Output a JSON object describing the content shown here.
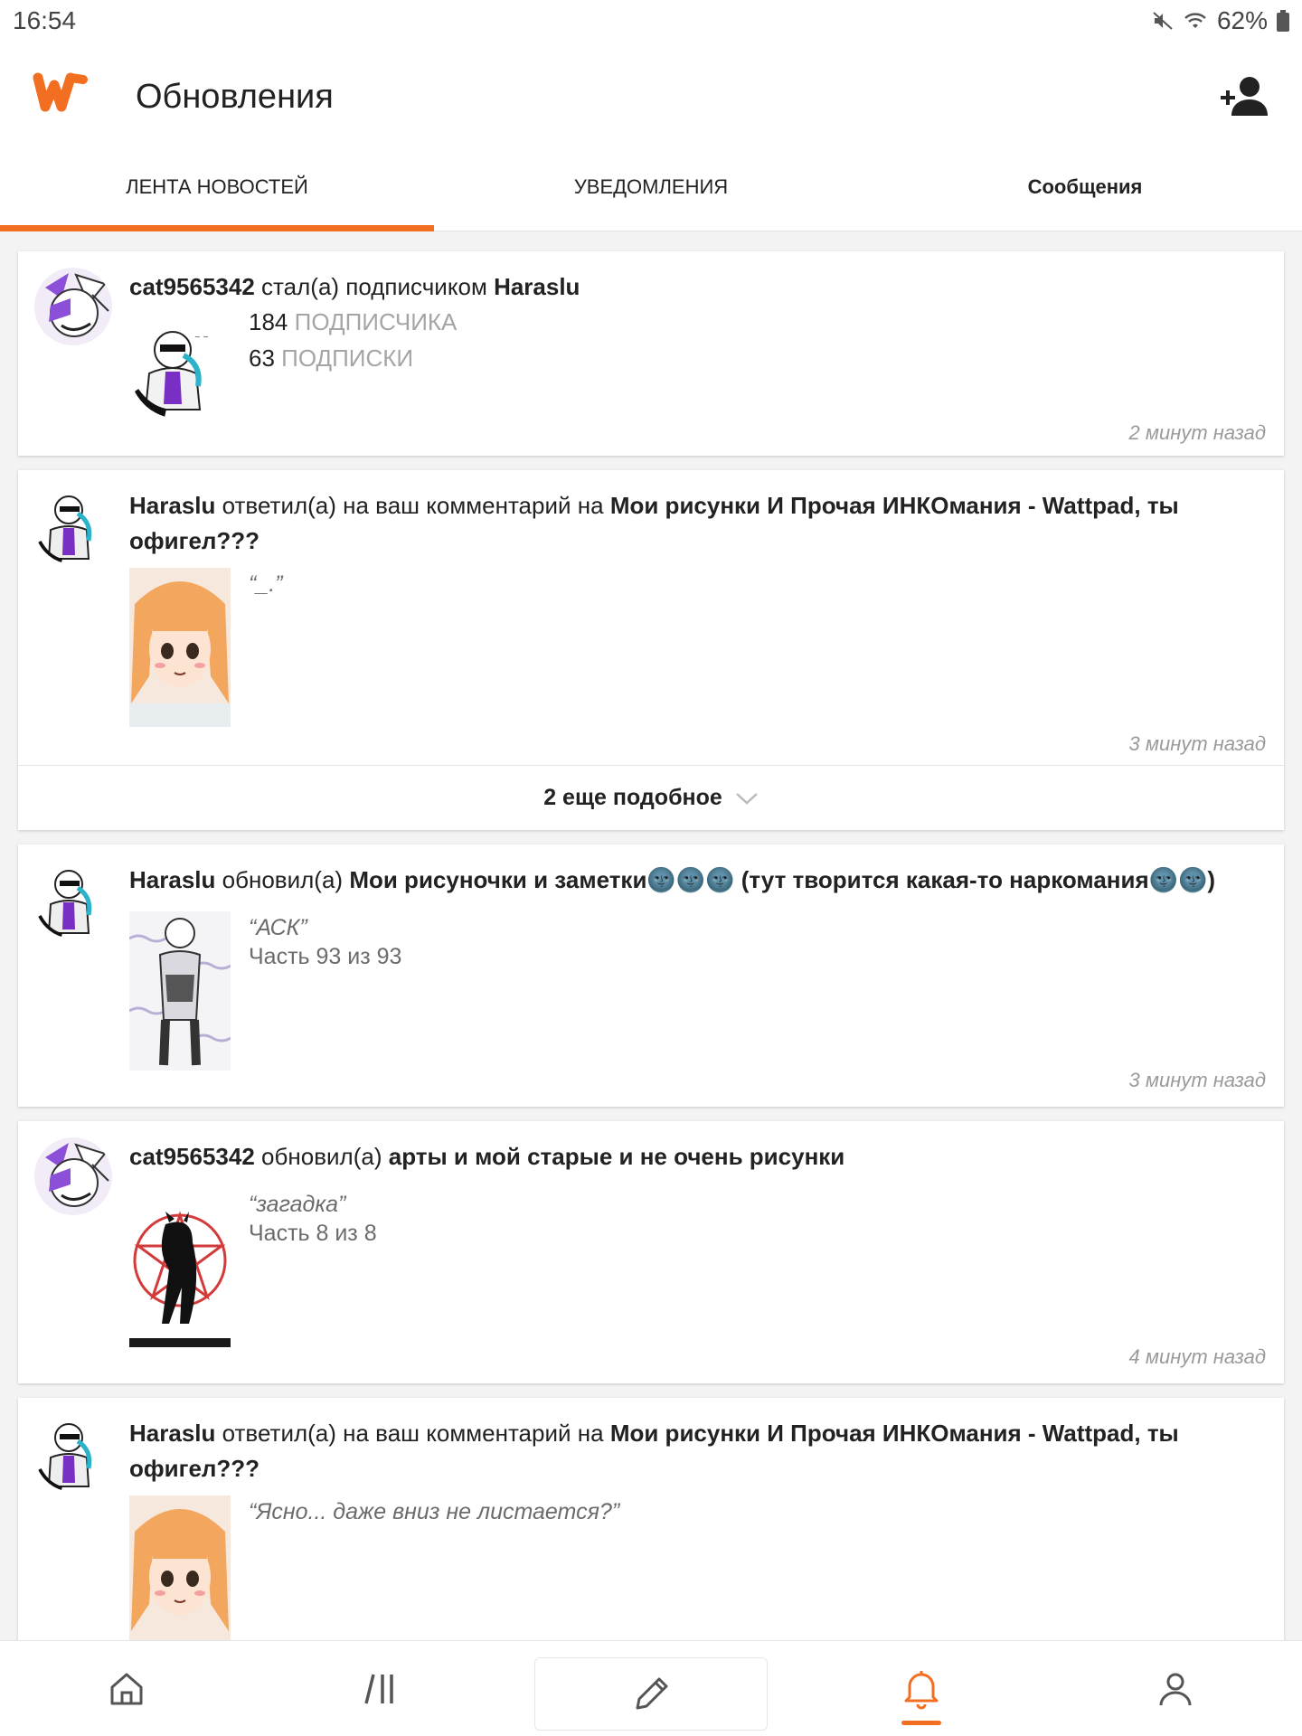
{
  "status_bar": {
    "time": "16:54",
    "battery": "62%"
  },
  "header": {
    "title": "Обновления"
  },
  "tabs": [
    {
      "label": "ЛЕНТА НОВОСТЕЙ"
    },
    {
      "label": "УВЕДОМЛЕНИЯ"
    },
    {
      "label": "Сообщения"
    }
  ],
  "feed": [
    {
      "user": "cat9565342",
      "action": "стал(а) подписчиком",
      "target": "Haraslu",
      "followers_count": "184",
      "followers_label": "ПОДПИСЧИКА",
      "following_count": "63",
      "following_label": "ПОДПИСКИ",
      "time": "2 минут назад"
    },
    {
      "user": "Haraslu",
      "action": "ответил(а) на ваш комментарий на",
      "target": "Мои рисунки И Прочая ИНКОмания - Wattpad, ты офигел???",
      "quote": "“_.”",
      "time": "3 минут назад",
      "more_label": "2 еще подобное"
    },
    {
      "user": "Haraslu",
      "action": "обновил(а)",
      "target": "Мои рисуночки и заметки🌚🌚🌚 (тут творится какая-то наркомания🌚🌚)",
      "quote": "“АСК”",
      "part": "Часть 93 из 93",
      "time": "3 минут назад"
    },
    {
      "user": "cat9565342",
      "action": "обновил(а)",
      "target": "арты и мой старые и не очень рисунки",
      "quote": "“загадка”",
      "part": "Часть 8 из 8",
      "time": "4 минут назад"
    },
    {
      "user": "Haraslu",
      "action": "ответил(а) на ваш комментарий на",
      "target": "Мои рисунки И Прочая ИНКОмания - Wattpad, ты офигел???",
      "quote": "“Ясно... даже вниз не листается?”"
    }
  ],
  "colors": {
    "accent": "#f26f21"
  },
  "bottom_nav": [
    "home-icon",
    "library-icon",
    "pencil-icon",
    "bell-icon",
    "profile-icon"
  ]
}
